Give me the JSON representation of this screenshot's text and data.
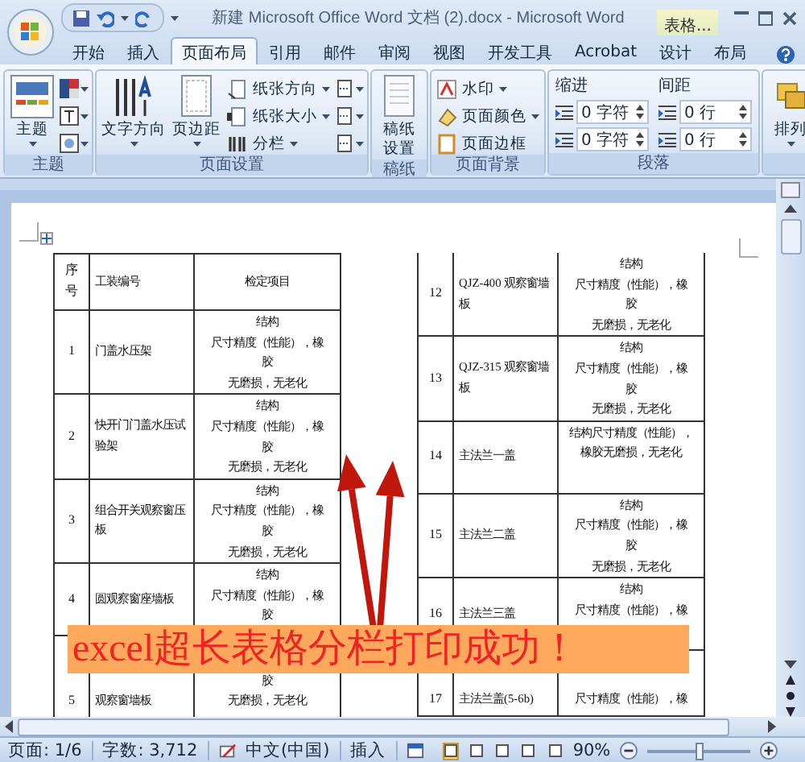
{
  "window": {
    "title": "新建 Microsoft Office Word 文档 (2).docx - Microsoft Word",
    "context_tab": "表格..."
  },
  "tabs": [
    {
      "label": "开始",
      "selected": false
    },
    {
      "label": "插入",
      "selected": false
    },
    {
      "label": "页面布局",
      "selected": true
    },
    {
      "label": "引用",
      "selected": false
    },
    {
      "label": "邮件",
      "selected": false
    },
    {
      "label": "审阅",
      "selected": false
    },
    {
      "label": "视图",
      "selected": false
    },
    {
      "label": "开发工具",
      "selected": false
    },
    {
      "label": "Acrobat",
      "selected": false
    },
    {
      "label": "设计",
      "selected": false
    },
    {
      "label": "布局",
      "selected": false
    }
  ],
  "ribbon": {
    "groups": [
      {
        "kind": "theme",
        "label": "主题",
        "large_buttons": [
          {
            "label": "主题",
            "dropdown": true
          }
        ]
      },
      {
        "kind": "page_setup",
        "label": "页面设置",
        "large_buttons": [
          {
            "label": "文字方向",
            "dropdown": true
          },
          {
            "label": "页边距",
            "dropdown": true
          }
        ],
        "small_buttons": [
          {
            "label": "纸张方向",
            "dropdown": true
          },
          {
            "label": "纸张大小",
            "dropdown": true
          },
          {
            "label": "分栏",
            "dropdown": true
          }
        ]
      },
      {
        "kind": "manuscript",
        "label": "稿纸",
        "large_buttons": [
          {
            "label": "稿纸设置",
            "dropdown": false
          }
        ]
      },
      {
        "kind": "background",
        "label": "页面背景",
        "small_buttons": [
          {
            "label": "水印",
            "dropdown": true
          },
          {
            "label": "页面颜色",
            "dropdown": true
          },
          {
            "label": "页面边框",
            "dropdown": false
          }
        ]
      },
      {
        "kind": "paragraph",
        "label": "段落",
        "spinner_sets": [
          {
            "label": "缩进",
            "values": [
              "0 字符",
              "0 字符"
            ]
          },
          {
            "label": "间距",
            "values": [
              "0 行",
              "0 行"
            ]
          }
        ]
      },
      {
        "kind": "arrange",
        "large_buttons": [
          {
            "label": "排列",
            "dropdown": true
          }
        ]
      }
    ]
  },
  "document": {
    "columns": [
      "序号",
      "工装编号",
      "检定项目"
    ],
    "left_rows": [
      {
        "number": "1",
        "name": "门盖水压架",
        "check": [
          "结构",
          "尺寸精度（性能），橡",
          "胶",
          "无磨损，无老化"
        ]
      },
      {
        "number": "2",
        "name": "快开门门盖水压试验架",
        "check": [
          "结构",
          "尺寸精度（性能），橡",
          "胶",
          "无磨损，无老化"
        ]
      },
      {
        "number": "3",
        "name": "组合开关观察窗压板",
        "check": [
          "结构",
          "尺寸精度（性能），橡",
          "胶",
          "无磨损，无老化"
        ]
      },
      {
        "number": "4",
        "name": "圆观察窗座墙板",
        "check": [
          "结构",
          "尺寸精度（性能），橡",
          "胶"
        ]
      },
      {
        "number": "5",
        "name": "观察窗墙板",
        "check": [
          "胶",
          "无磨损，无老化"
        ]
      }
    ],
    "right_rows": [
      {
        "number": "12",
        "name": "QJZ-400 观察窗墙板",
        "check": [
          "结构",
          "尺寸精度（性能），橡",
          "胶",
          "无磨损，无老化"
        ]
      },
      {
        "number": "13",
        "name": "QJZ-315 观察窗墙板",
        "check": [
          "结构",
          "尺寸精度（性能），橡",
          "胶",
          "无磨损，无老化"
        ]
      },
      {
        "number": "14",
        "name": "主法兰一盖",
        "check": [
          "结构尺寸精度（性能），",
          "橡胶无磨损，无老化"
        ]
      },
      {
        "number": "15",
        "name": "主法兰二盖",
        "check": [
          "结构",
          "尺寸精度（性能），橡",
          "胶",
          "无磨损，无老化"
        ]
      },
      {
        "number": "16",
        "name": "主法兰三盖",
        "check": [
          "结构",
          "尺寸精度（性能），橡"
        ]
      },
      {
        "number": "17",
        "name": "主法兰盖(5-6b)",
        "check": [
          "尺寸精度（性能），橡"
        ]
      }
    ]
  },
  "annotation": "excel超长表格分栏打印成功！",
  "status_bar": {
    "page": "页面: 1/6",
    "word_count": "字数: 3,712",
    "language": "中文(中国)",
    "mode": "插入",
    "views": [
      {
        "selected": true
      },
      {
        "selected": false
      },
      {
        "selected": false
      },
      {
        "selected": false
      },
      {
        "selected": false
      }
    ],
    "zoom": "90%",
    "zoom_slider": {
      "level": 0.5
    }
  }
}
